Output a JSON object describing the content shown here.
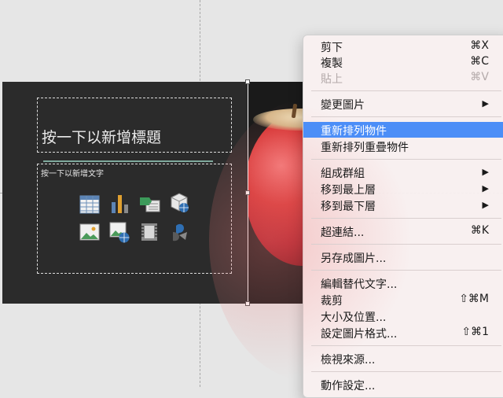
{
  "slide": {
    "title_placeholder": "按一下以新增標題",
    "body_placeholder": "按一下以新增文字"
  },
  "insert_icons": [
    "table-icon",
    "chart-icon",
    "smartart-icon",
    "3d-model-icon",
    "picture-icon",
    "online-picture-icon",
    "video-icon",
    "icons-icon"
  ],
  "menu": {
    "cut": {
      "label": "剪下",
      "shortcut": "⌘X"
    },
    "copy": {
      "label": "複製",
      "shortcut": "⌘C"
    },
    "paste": {
      "label": "貼上",
      "shortcut": "⌘V"
    },
    "change_picture": {
      "label": "變更圖片"
    },
    "reorder_objects": {
      "label": "重新排列物件"
    },
    "reorder_overlapping": {
      "label": "重新排列重疊物件"
    },
    "group": {
      "label": "組成群組"
    },
    "bring_to_front": {
      "label": "移到最上層"
    },
    "send_to_back": {
      "label": "移到最下層"
    },
    "hyperlink": {
      "label": "超連結...",
      "shortcut": "⌘K"
    },
    "save_as_picture": {
      "label": "另存成圖片..."
    },
    "edit_alt_text": {
      "label": "編輯替代文字..."
    },
    "crop": {
      "label": "裁剪",
      "shortcut": "⇧⌘M"
    },
    "size_position": {
      "label": "大小及位置..."
    },
    "format_picture": {
      "label": "設定圖片格式...",
      "shortcut": "⇧⌘1"
    },
    "view_source": {
      "label": "檢視來源..."
    },
    "action_settings": {
      "label": "動作設定..."
    }
  },
  "colors": {
    "highlight": "#4c8ef7",
    "slide_bg": "#2b2b2b"
  }
}
